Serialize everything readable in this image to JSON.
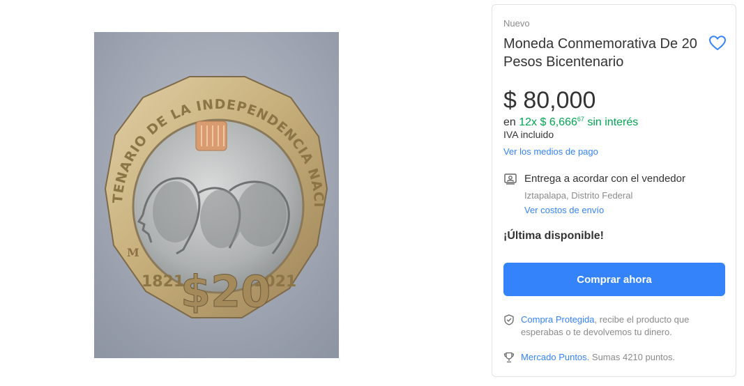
{
  "product": {
    "condition": "Nuevo",
    "title": "Moneda Conmemorativa De 20 Pesos Bicentenario",
    "image_alt": "Moneda de 20 pesos Bicentenario de la Independencia Nacional 1821 2021"
  },
  "coin": {
    "inscription": "BICENTENARIO DE LA INDEPENDENCIA NACIONAL",
    "denomination": "$20",
    "year_left": "1821",
    "year_right": "2021",
    "mint_mark": "M"
  },
  "price": {
    "main": "$ 80,000",
    "installments_prefix": "en",
    "installments_amount": "12x $ 6,666",
    "installments_cents": "67",
    "installments_suffix": "sin interés",
    "tax_note": "IVA incluido",
    "payment_methods_link": "Ver los medios de pago"
  },
  "delivery": {
    "title": "Entrega a acordar con el vendedor",
    "location": "Iztapalapa, Distrito Federal",
    "shipping_costs_link": "Ver costos de envío"
  },
  "stock": {
    "label": "¡Última disponible!"
  },
  "actions": {
    "buy_now_label": "Comprar ahora"
  },
  "protection": {
    "link": "Compra Protegida",
    "text": ", recibe el producto que esperabas o te devolvemos tu dinero."
  },
  "points": {
    "link": "Mercado Puntos.",
    "text": " Sumas 4210 puntos."
  },
  "colors": {
    "accent": "#3483fa",
    "green": "#00a650",
    "muted": "#8a8a8a",
    "text": "#333333"
  },
  "icons": {
    "favorite": "heart-icon",
    "delivery": "delivery-agreement-icon",
    "protection": "shield-check-icon",
    "points": "trophy-icon"
  }
}
